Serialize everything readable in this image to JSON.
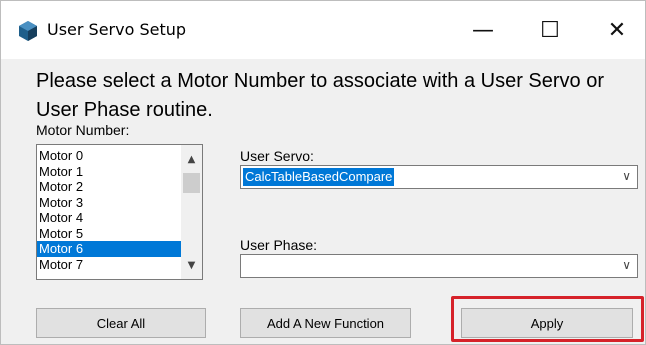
{
  "window": {
    "title": "User Servo Setup",
    "controls": {
      "minimize": "—",
      "maximize": "☐",
      "close": "✕"
    },
    "icon": "hex-cube-icon"
  },
  "prompt": "Please select a Motor Number to associate with a User Servo or User Phase routine.",
  "motor": {
    "label": "Motor Number:",
    "items": [
      "Motor 0",
      "Motor 1",
      "Motor 2",
      "Motor 3",
      "Motor 4",
      "Motor 5",
      "Motor 6",
      "Motor 7"
    ],
    "selected": "Motor 6"
  },
  "servo": {
    "label": "User Servo:",
    "value": "CalcTableBasedCompare"
  },
  "phase": {
    "label": "User Phase:",
    "value": ""
  },
  "buttons": {
    "clear_all": "Clear All",
    "add_function": "Add A New Function",
    "apply": "Apply"
  },
  "colors": {
    "selection": "#0078d7",
    "highlight": "#d6222a",
    "button_face": "#e1e1e1"
  }
}
